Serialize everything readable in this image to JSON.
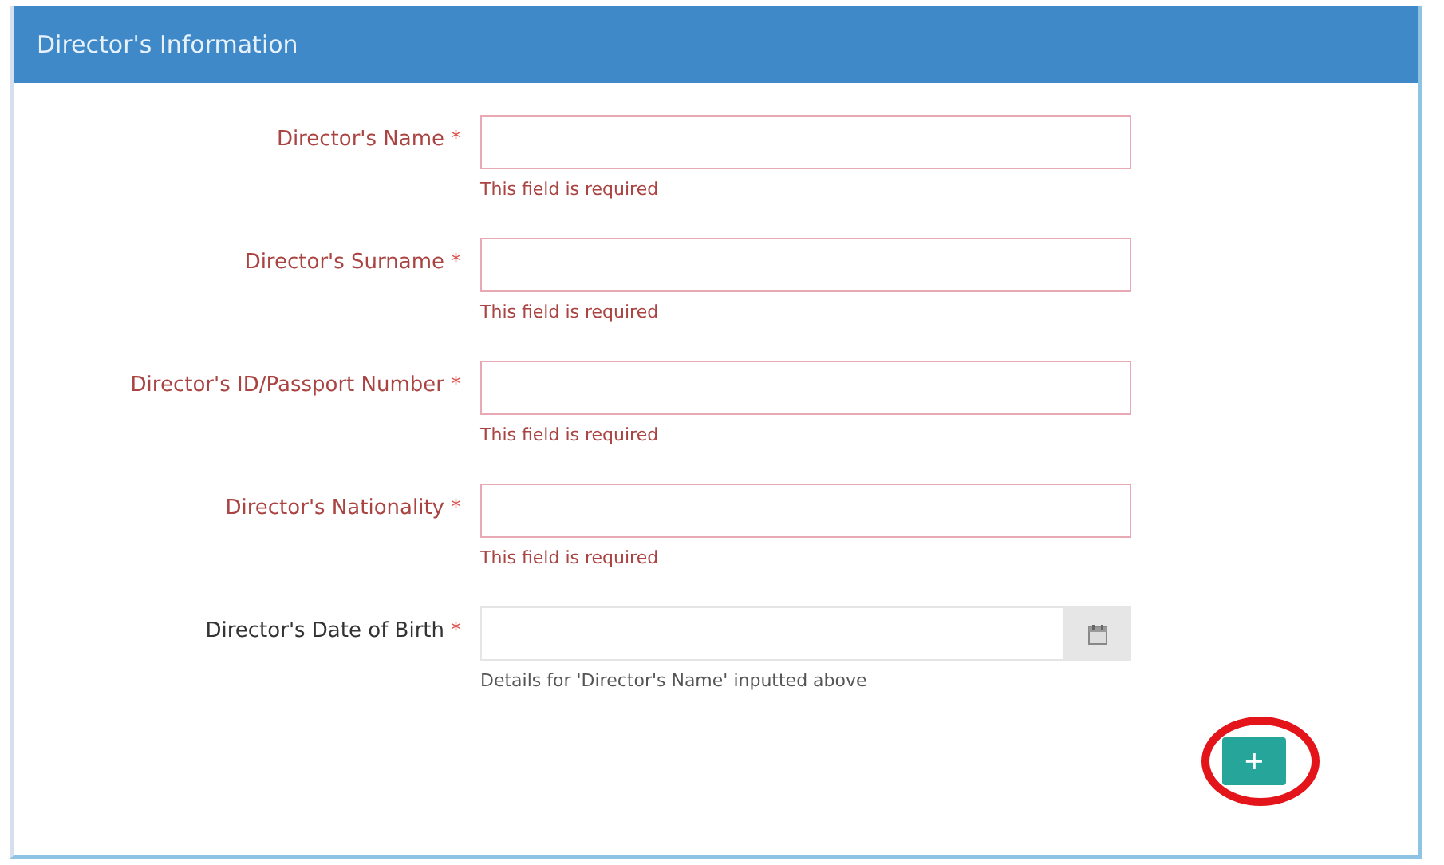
{
  "panel": {
    "title": "Director's Information"
  },
  "fields": [
    {
      "kind": "text",
      "label": "Director's Name",
      "required_mark": "*",
      "invalid": true,
      "help": "This field is required"
    },
    {
      "kind": "text",
      "label": "Director's Surname",
      "required_mark": "*",
      "invalid": true,
      "help": "This field is required"
    },
    {
      "kind": "text",
      "label": "Director's ID/Passport Number",
      "required_mark": "*",
      "invalid": true,
      "help": "This field is required"
    },
    {
      "kind": "text",
      "label": "Director's Nationality",
      "required_mark": "*",
      "invalid": true,
      "help": "This field is required"
    },
    {
      "kind": "date",
      "label": "Director's Date of Birth",
      "required_mark": "*",
      "invalid": false,
      "help": "Details for 'Director's Name' inputted above"
    }
  ],
  "add_button": {
    "label": "+",
    "highlighted": true
  }
}
